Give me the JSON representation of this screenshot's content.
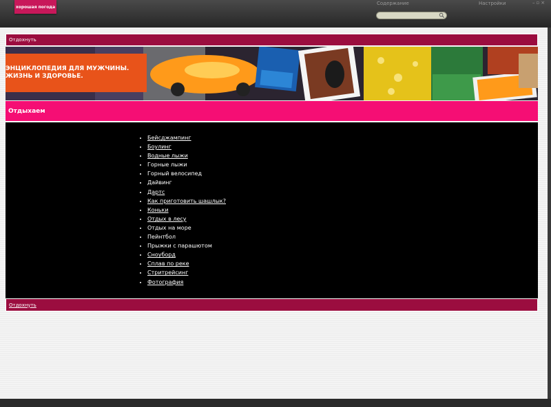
{
  "topbar": {
    "brand": "хорошая погода",
    "contents_link": "Содержание",
    "settings_link": "Настройки",
    "controls": [
      "–",
      "▫",
      "×"
    ],
    "search": {
      "value": "",
      "placeholder": ""
    }
  },
  "header": {
    "label": "Отдохнуть"
  },
  "banner": {
    "line1": "ЭНЦИКЛОПЕДИЯ ДЛЯ МУЖЧИНЫ.",
    "line2": "ЖИЗНЬ И ЗДОРОВЬЕ."
  },
  "section": {
    "title": "Отдыхаем"
  },
  "items": [
    {
      "label": "Бейсджампинг",
      "link": true
    },
    {
      "label": "Боулинг",
      "link": true
    },
    {
      "label": "Водные лыжи",
      "link": true
    },
    {
      "label": "Горные лыжи",
      "link": false
    },
    {
      "label": "Горный велосипед",
      "link": false
    },
    {
      "label": "Дайвинг",
      "link": false
    },
    {
      "label": "Дартс",
      "link": true
    },
    {
      "label": "Как приготовить шашлык?",
      "link": true
    },
    {
      "label": "Коньки",
      "link": true
    },
    {
      "label": "Отдых в лесу",
      "link": true
    },
    {
      "label": "Отдых на море",
      "link": false
    },
    {
      "label": "Пейнтбол",
      "link": false
    },
    {
      "label": "Прыжки с парашютом",
      "link": false
    },
    {
      "label": "Сноуборд",
      "link": true
    },
    {
      "label": "Сплав по реке",
      "link": true
    },
    {
      "label": "Стритрейсинг",
      "link": true
    },
    {
      "label": "Фотография",
      "link": true
    }
  ],
  "footer": {
    "label": "Отдохнуть"
  },
  "colors": {
    "header_bar": "#9b0d3f",
    "section_bar": "#f50e74",
    "banner_orange": "#e8531a",
    "brand": "#c8185a"
  }
}
